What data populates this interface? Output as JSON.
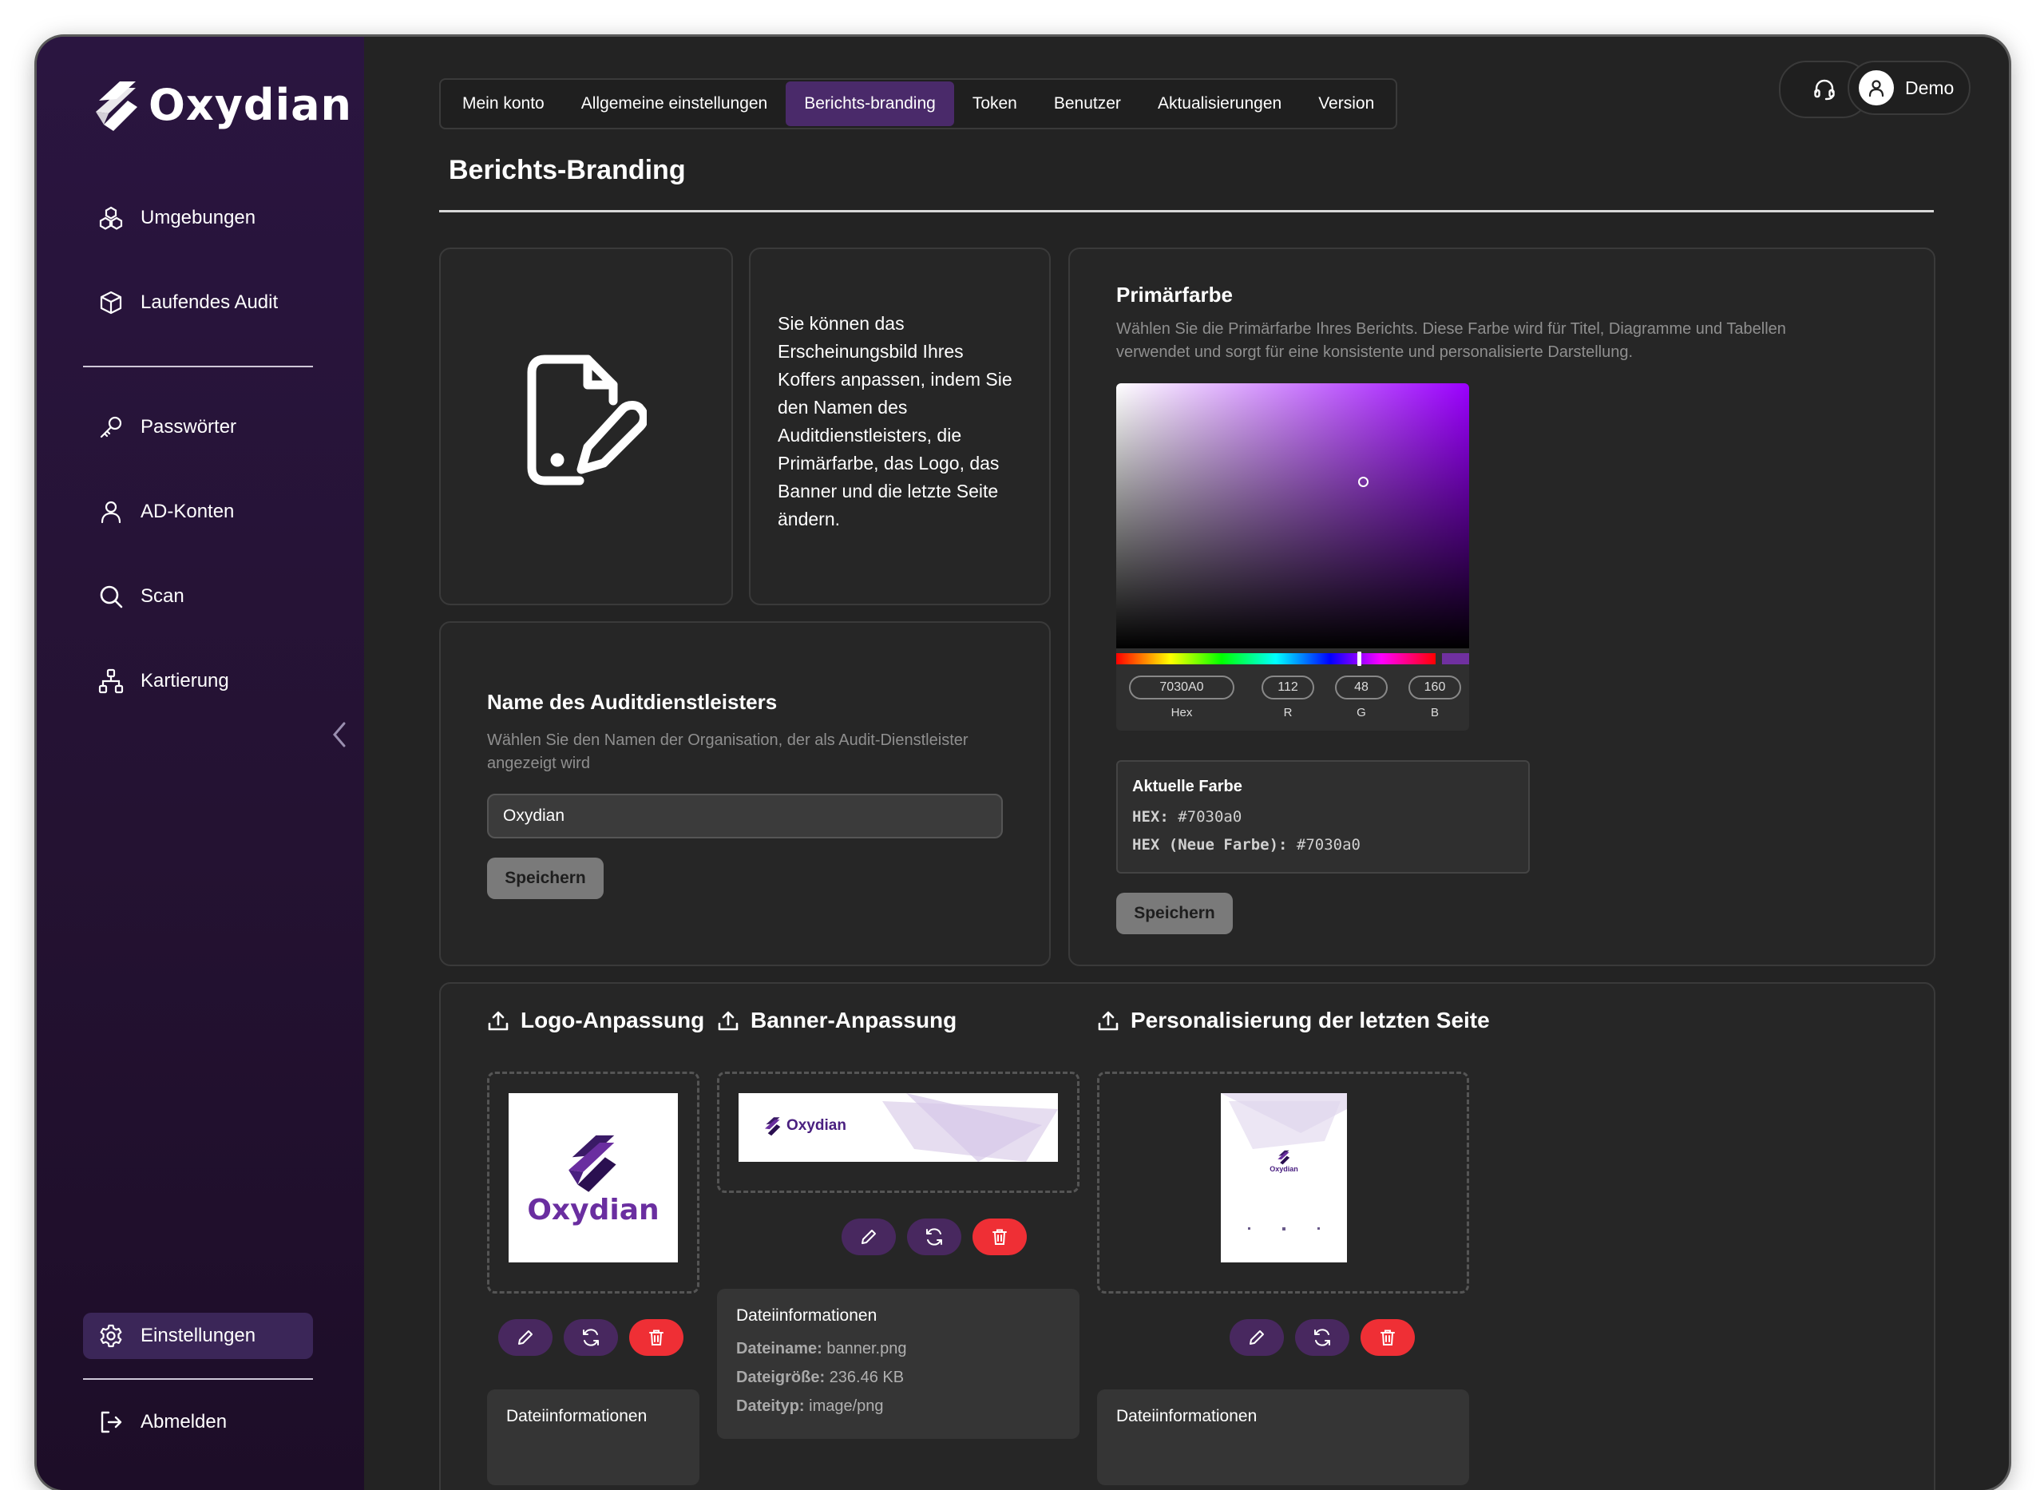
{
  "app": {
    "brand": "Oxydian"
  },
  "sidebar": {
    "items": [
      {
        "label": "Umgebungen",
        "icon": "environments-icon"
      },
      {
        "label": "Laufendes Audit",
        "icon": "box-icon"
      },
      {
        "label": "Passwörter",
        "icon": "key-icon"
      },
      {
        "label": "AD-Konten",
        "icon": "user-icon"
      },
      {
        "label": "Scan",
        "icon": "search-icon"
      },
      {
        "label": "Kartierung",
        "icon": "sitemap-icon"
      }
    ],
    "settings_label": "Einstellungen",
    "logout_label": "Abmelden"
  },
  "tabs": [
    {
      "label": "Mein konto",
      "active": false
    },
    {
      "label": "Allgemeine einstellungen",
      "active": false
    },
    {
      "label": "Berichts-branding",
      "active": true
    },
    {
      "label": "Token",
      "active": false
    },
    {
      "label": "Benutzer",
      "active": false
    },
    {
      "label": "Aktualisierungen",
      "active": false
    },
    {
      "label": "Version",
      "active": false
    }
  ],
  "header": {
    "user_name": "Demo"
  },
  "page": {
    "title": "Berichts-Branding"
  },
  "intro": {
    "text": "Sie können das Erscheinungsbild Ihres Koffers anpassen, indem Sie den Namen des Auditdienstleisters, die Primärfarbe, das Logo, das Banner und die letzte Seite ändern."
  },
  "provider": {
    "title": "Name des Auditdienstleisters",
    "description": "Wählen Sie den Namen der Organisation, der als Audit-Dienstleister angezeigt wird",
    "value": "Oxydian",
    "save_label": "Speichern"
  },
  "color": {
    "title": "Primärfarbe",
    "description": "Wählen Sie die Primärfarbe Ihres Berichts. Diese Farbe wird für Titel, Diagramme und Tabellen verwendet und sorgt für eine konsistente und personalisierte Darstellung.",
    "hex": "7030A0",
    "r": "112",
    "g": "48",
    "b": "160",
    "hex_label": "Hex",
    "r_label": "R",
    "g_label": "G",
    "b_label": "B",
    "current_title": "Aktuelle Farbe",
    "current_hex_label": "HEX:",
    "current_hex_value": "#7030a0",
    "new_hex_label": "HEX (Neue Farbe):",
    "new_hex_value": "#7030a0",
    "save_label": "Speichern",
    "accent": "#7030a0"
  },
  "uploads": {
    "logo": {
      "title": "Logo-Anpassung",
      "preview_text": "Oxydian",
      "info_title": "Dateiinformationen"
    },
    "banner": {
      "title": "Banner-Anpassung",
      "preview_text": "Oxydian",
      "info_title": "Dateiinformationen",
      "name_label": "Dateiname:",
      "name_value": "banner.png",
      "size_label": "Dateigröße:",
      "size_value": "236.46 KB",
      "type_label": "Dateityp:",
      "type_value": "image/png"
    },
    "lastpage": {
      "title": "Personalisierung der letzten Seite",
      "preview_text": "Oxydian",
      "info_title": "Dateiinformationen"
    }
  }
}
